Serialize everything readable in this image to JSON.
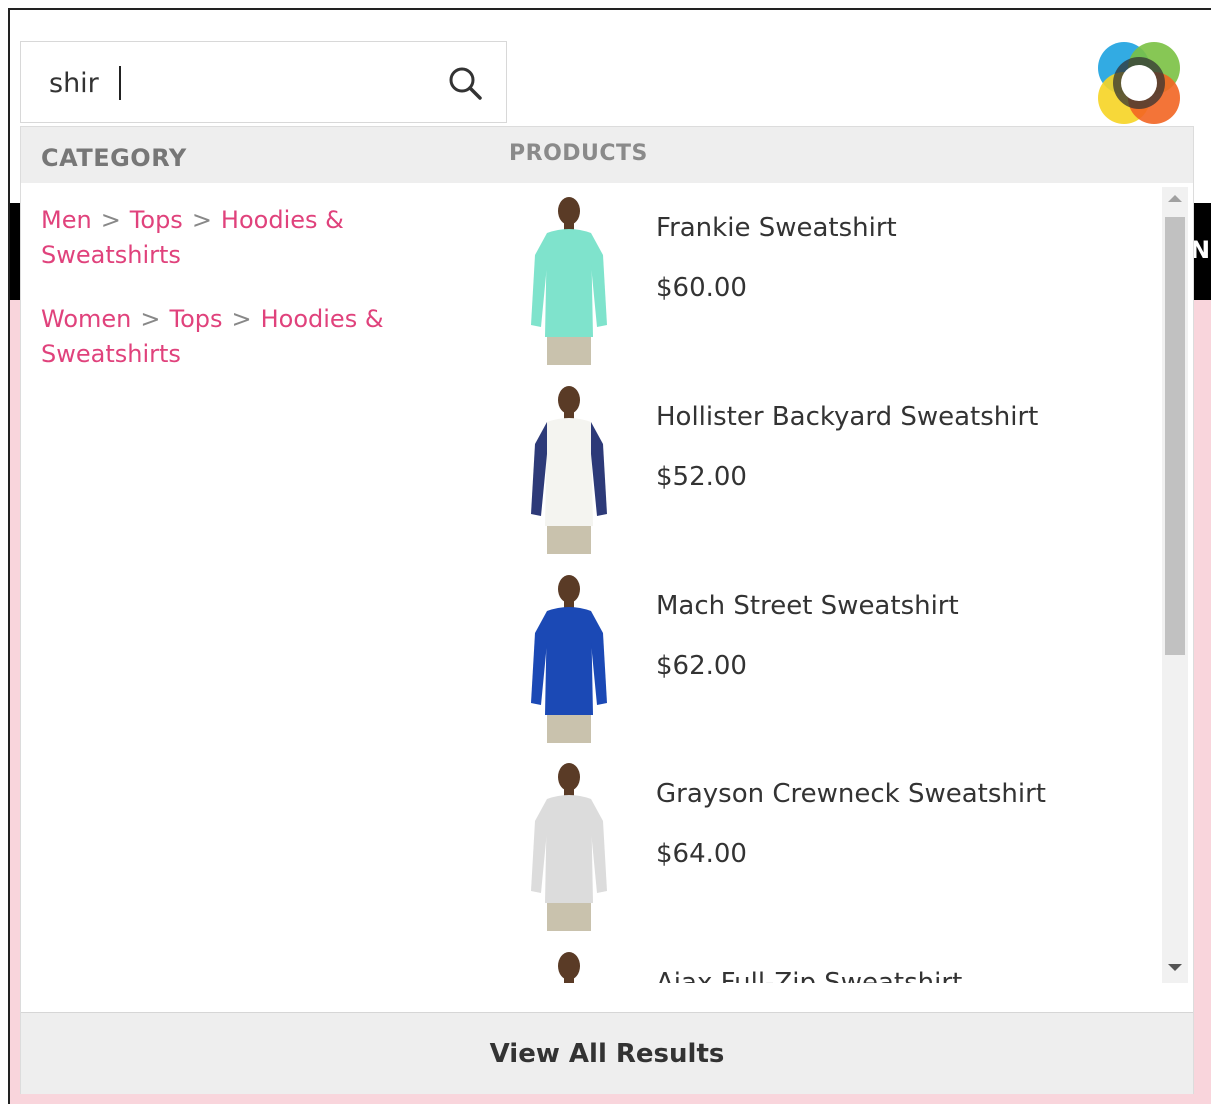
{
  "search": {
    "value": "shir"
  },
  "dropdown": {
    "category_header": "CATEGORY",
    "products_header": "PRODUCTS",
    "categories": [
      {
        "path": [
          "Men",
          "Tops",
          "Hoodies & Sweatshirts"
        ]
      },
      {
        "path": [
          "Women",
          "Tops",
          "Hoodies & Sweatshirts"
        ]
      }
    ],
    "separator": ">",
    "products": [
      {
        "name": "Frankie Sweatshirt",
        "price": "$60.00",
        "shirt_color": "#7fe3cc",
        "sleeve_color": "#7fe3cc"
      },
      {
        "name": "Hollister Backyard Sweatshirt",
        "price": "$52.00",
        "shirt_color": "#f4f4f0",
        "sleeve_color": "#2d3a78"
      },
      {
        "name": "Mach Street Sweatshirt",
        "price": "$62.00",
        "shirt_color": "#1b49b5",
        "sleeve_color": "#1b49b5"
      },
      {
        "name": "Grayson Crewneck Sweatshirt",
        "price": "$64.00",
        "shirt_color": "#dcdcdc",
        "sleeve_color": "#dcdcdc"
      },
      {
        "name": "Ajax Full-Zip Sweatshirt",
        "price": "",
        "shirt_color": "#888888",
        "sleeve_color": "#888888"
      }
    ],
    "view_all": "View All Results"
  },
  "colors": {
    "accent_link": "#e0427c",
    "header_bg": "#eeeeee",
    "page_pink": "#f9d5dc"
  }
}
